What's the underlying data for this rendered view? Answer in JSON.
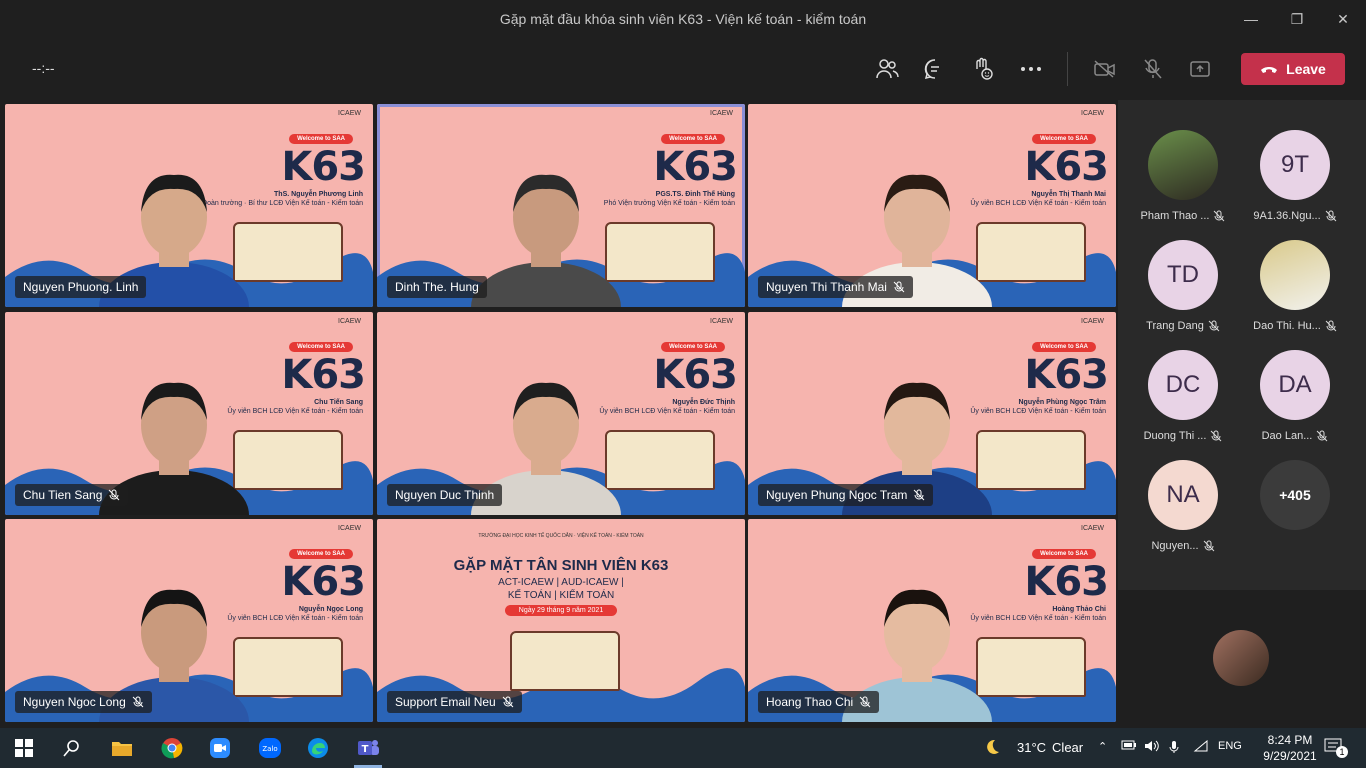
{
  "window": {
    "title": "Gặp mặt đầu khóa sinh viên K63 - Viện kế toán - kiểm toán"
  },
  "toolbar": {
    "timer": "--:--",
    "leave_label": "Leave"
  },
  "tiles": [
    {
      "name": "Nguyen Phuong. Linh",
      "muted": false,
      "speaker": "ThS. Nguyễn Phương Linh",
      "role": "Phó Bí thư Đoàn trường · Bí thư LCĐ Viện Kế toán - Kiểm toán",
      "welcome": "Welcome to SAA",
      "k63": "K63",
      "brand": "ICAEW"
    },
    {
      "name": "Dinh The. Hung",
      "muted": false,
      "speaker": "PGS.TS. Đinh Thế Hùng",
      "role": "Phó Viện trưởng Viện Kế toán - Kiểm toán",
      "welcome": "Welcome to SAA",
      "k63": "K63",
      "brand": "ICAEW"
    },
    {
      "name": "Nguyen Thi Thanh Mai",
      "muted": true,
      "speaker": "Nguyễn Thị Thanh Mai",
      "role": "Ủy viên BCH LCĐ Viện Kế toán - Kiểm toán",
      "welcome": "Welcome to SAA",
      "k63": "K63",
      "brand": "ICAEW"
    },
    {
      "name": "Chu Tien Sang",
      "muted": true,
      "speaker": "Chu Tiến Sang",
      "role": "Ủy viên BCH LCĐ Viện Kế toán - Kiểm toán",
      "welcome": "Welcome to SAA",
      "k63": "K63",
      "brand": "ICAEW"
    },
    {
      "name": "Nguyen Duc Thinh",
      "muted": false,
      "speaker": "Nguyễn Đức Thịnh",
      "role": "Ủy viên BCH LCĐ Viện Kế toán - Kiểm toán",
      "welcome": "Welcome to SAA",
      "k63": "K63",
      "brand": "ICAEW"
    },
    {
      "name": "Nguyen Phung Ngoc Tram",
      "muted": true,
      "speaker": "Nguyễn Phùng Ngọc Trâm",
      "role": "Ủy viên BCH LCĐ Viện Kế toán - Kiểm toán",
      "welcome": "Welcome to SAA",
      "k63": "K63",
      "brand": "ICAEW"
    },
    {
      "name": "Nguyen Ngoc Long",
      "muted": true,
      "speaker": "Nguyễn Ngọc Long",
      "role": "Ủy viên BCH LCĐ Viện Kế toán - Kiểm toán",
      "welcome": "Welcome to SAA",
      "k63": "K63",
      "brand": "ICAEW"
    },
    {
      "name": "Support Email Neu",
      "muted": true,
      "banner_title": "GẶP MẶT TÂN SINH VIÊN K63",
      "banner_line1": "ACT-ICAEW | AUD-ICAEW |",
      "banner_line2": "KẾ TOÁN | KIỂM TOÁN",
      "banner_date": "Ngày 29 tháng 9 năm 2021",
      "banner_header": "TRƯỜNG ĐẠI HỌC KINH TẾ QUỐC DÂN · VIỆN KẾ TOÁN - KIỂM TOÁN"
    },
    {
      "name": "Hoang Thao Chi",
      "muted": true,
      "speaker": "Hoàng Thảo Chi",
      "role": "Ủy viên BCH LCĐ Viện Kế toán - Kiểm toán",
      "welcome": "Welcome to SAA",
      "k63": "K63",
      "brand": "ICAEW"
    }
  ],
  "participants": [
    {
      "initials": "",
      "name": "Pham Thao ...",
      "photo": true
    },
    {
      "initials": "9T",
      "name": "9A1.36.Ngu..."
    },
    {
      "initials": "TD",
      "name": "Trang Dang"
    },
    {
      "initials": "",
      "name": "Dao Thi. Hu...",
      "photo": true
    },
    {
      "initials": "DC",
      "name": "Duong Thi ..."
    },
    {
      "initials": "DA",
      "name": "Dao Lan..."
    },
    {
      "initials": "NA",
      "name": "Nguyen..."
    },
    {
      "initials": "+405",
      "name": ""
    }
  ],
  "taskbar": {
    "temperature": "31°C",
    "weather": "Clear",
    "lang": "ENG",
    "time": "8:24 PM",
    "date": "9/29/2021",
    "notif_count": "1"
  },
  "colors": {
    "leave": "#c4314b",
    "tile_bg": "#f6b4ae",
    "active_border": "#8b8fd6",
    "avatar_bg": "#e8d3e6"
  }
}
